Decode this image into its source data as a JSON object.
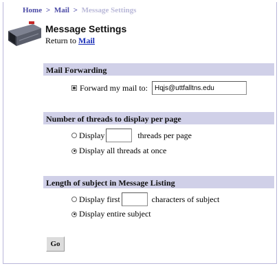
{
  "breadcrumb": {
    "home": "Home",
    "mail": "Mail",
    "current": "Message Settings",
    "separator": ">"
  },
  "header": {
    "title": "Message Settings",
    "return_prefix": "Return to",
    "return_link": "Mail"
  },
  "forwarding": {
    "heading": "Mail Forwarding",
    "checkbox_label": "Forward my mail to:",
    "checked": true,
    "email_value": "Hqjs@uttfalltns.edu"
  },
  "threads": {
    "heading": "Number of threads to display per page",
    "option_display": "Display",
    "option_display_suffix": "threads per page",
    "per_page_value": "",
    "option_all": "Display all threads at once",
    "selected": "all"
  },
  "subject_length": {
    "heading": "Length of subject in Message Listing",
    "option_first": "Display first",
    "option_first_suffix": "characters of subject",
    "chars_value": "",
    "option_entire": "Display entire subject",
    "selected": "entire"
  },
  "actions": {
    "go_label": "Go"
  },
  "colors": {
    "section_bg": "#d0d0e8",
    "breadcrumb": "#4b4aa6",
    "link": "#1a2fb8"
  }
}
